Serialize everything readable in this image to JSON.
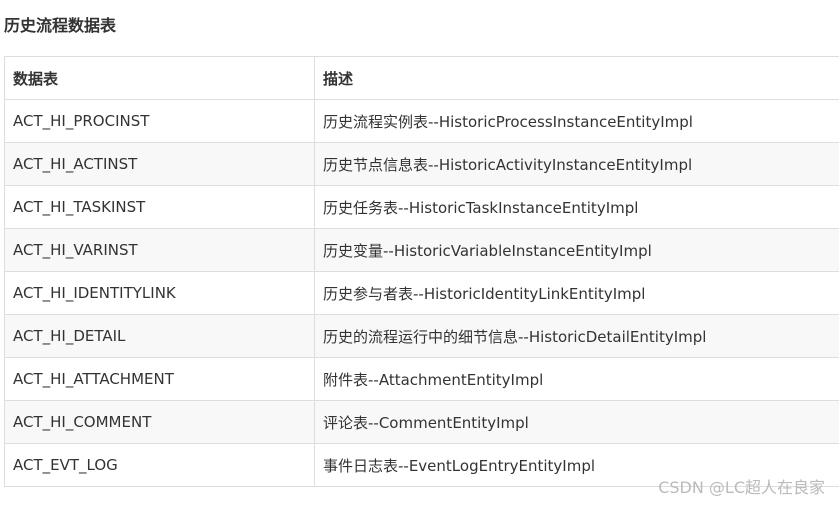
{
  "section_title": "历史流程数据表",
  "table": {
    "headers": [
      "数据表",
      "描述"
    ],
    "rows": [
      [
        "ACT_HI_PROCINST",
        "历史流程实例表--HistoricProcessInstanceEntityImpl"
      ],
      [
        "ACT_HI_ACTINST",
        "历史节点信息表--HistoricActivityInstanceEntityImpl"
      ],
      [
        "ACT_HI_TASKINST",
        "历史任务表--HistoricTaskInstanceEntityImpl"
      ],
      [
        "ACT_HI_VARINST",
        "历史变量--HistoricVariableInstanceEntityImpl"
      ],
      [
        "ACT_HI_IDENTITYLINK",
        "历史参与者表--HistoricIdentityLinkEntityImpl"
      ],
      [
        "ACT_HI_DETAIL",
        "历史的流程运行中的细节信息--HistoricDetailEntityImpl"
      ],
      [
        "ACT_HI_ATTACHMENT",
        "附件表--AttachmentEntityImpl"
      ],
      [
        "ACT_HI_COMMENT",
        "评论表--CommentEntityImpl"
      ],
      [
        "ACT_EVT_LOG",
        "事件日志表--EventLogEntryEntityImpl"
      ]
    ]
  },
  "watermark": "CSDN @LC超人在良家"
}
